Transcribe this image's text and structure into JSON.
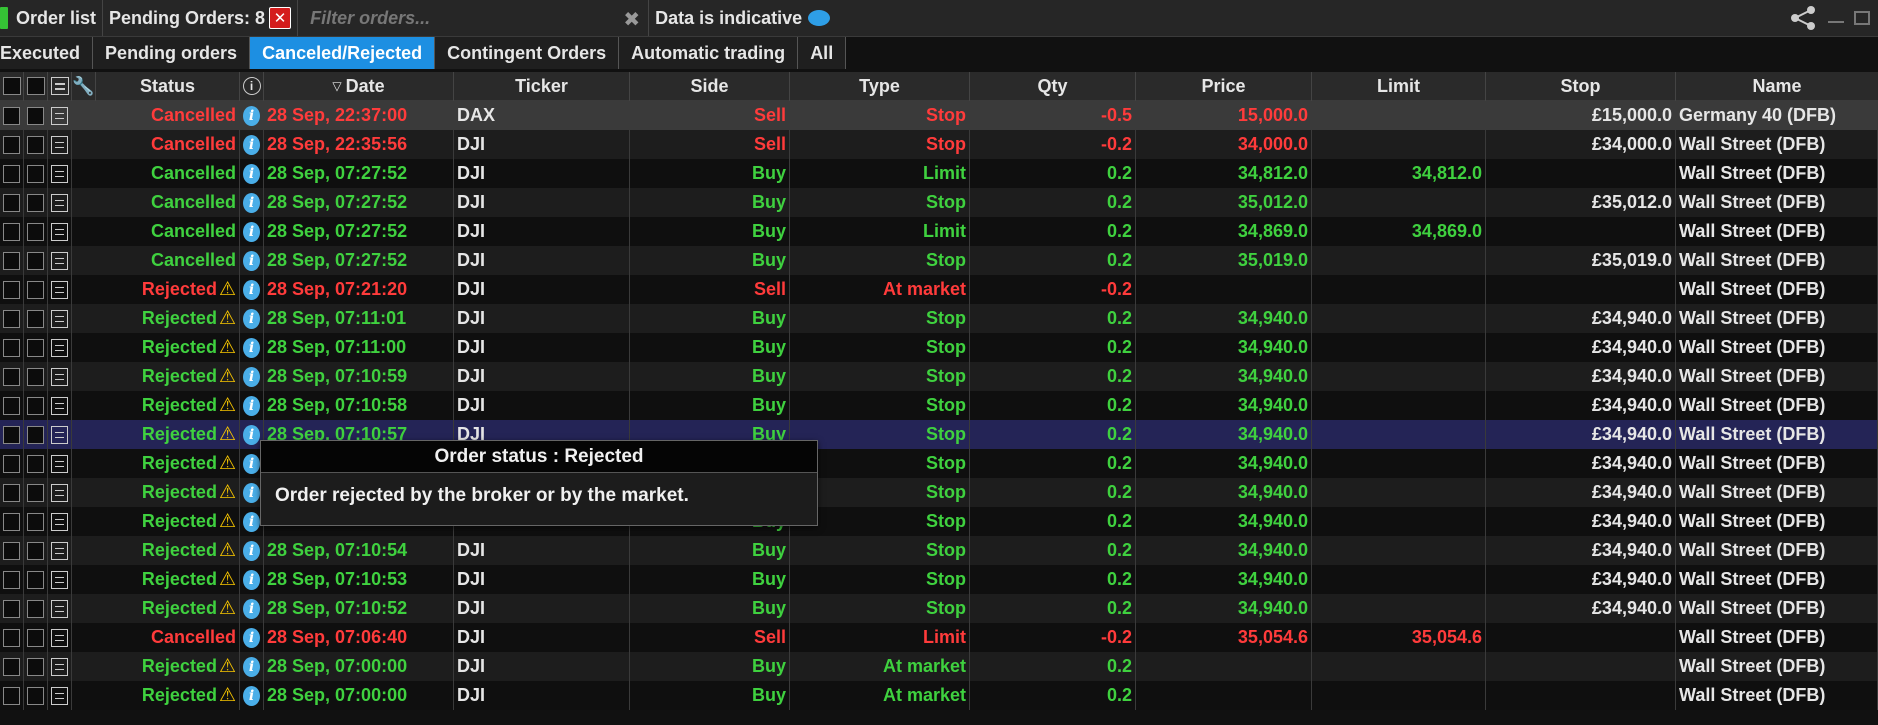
{
  "titlebar": {
    "order_list": "Order list",
    "pending_orders": "Pending Orders: 8",
    "filter_placeholder": "Filter orders...",
    "data_indicative": "Data is indicative"
  },
  "tabs": [
    {
      "label": "Executed",
      "active": false
    },
    {
      "label": "Pending orders",
      "active": false
    },
    {
      "label": "Canceled/Rejected",
      "active": true
    },
    {
      "label": "Contingent Orders",
      "active": false
    },
    {
      "label": "Automatic trading",
      "active": false
    },
    {
      "label": "All",
      "active": false
    }
  ],
  "columns": {
    "status": "Status",
    "date": "Date",
    "ticker": "Ticker",
    "side": "Side",
    "type": "Type",
    "qty": "Qty",
    "price": "Price",
    "limit": "Limit",
    "stop": "Stop",
    "name": "Name"
  },
  "colors": {
    "buy": "#3fd13f",
    "sell": "#ff3b3b",
    "active_tab": "#1d8fe2",
    "highlight_row": "#242456"
  },
  "rows": [
    {
      "status": "Cancelled",
      "warn": false,
      "date": "28 Sep, 22:37:00",
      "ticker": "DAX",
      "side": "Sell",
      "type": "Stop",
      "qty": "-0.5",
      "price": "15,000.0",
      "limit": "",
      "stop": "£15,000.0",
      "name": "Germany 40 (DFB)"
    },
    {
      "status": "Cancelled",
      "warn": false,
      "date": "28 Sep, 22:35:56",
      "ticker": "DJI",
      "side": "Sell",
      "type": "Stop",
      "qty": "-0.2",
      "price": "34,000.0",
      "limit": "",
      "stop": "£34,000.0",
      "name": "Wall Street (DFB)"
    },
    {
      "status": "Cancelled",
      "warn": false,
      "date": "28 Sep, 07:27:52",
      "ticker": "DJI",
      "side": "Buy",
      "type": "Limit",
      "qty": "0.2",
      "price": "34,812.0",
      "limit": "34,812.0",
      "stop": "",
      "name": "Wall Street (DFB)"
    },
    {
      "status": "Cancelled",
      "warn": false,
      "date": "28 Sep, 07:27:52",
      "ticker": "DJI",
      "side": "Buy",
      "type": "Stop",
      "qty": "0.2",
      "price": "35,012.0",
      "limit": "",
      "stop": "£35,012.0",
      "name": "Wall Street (DFB)"
    },
    {
      "status": "Cancelled",
      "warn": false,
      "date": "28 Sep, 07:27:52",
      "ticker": "DJI",
      "side": "Buy",
      "type": "Limit",
      "qty": "0.2",
      "price": "34,869.0",
      "limit": "34,869.0",
      "stop": "",
      "name": "Wall Street (DFB)"
    },
    {
      "status": "Cancelled",
      "warn": false,
      "date": "28 Sep, 07:27:52",
      "ticker": "DJI",
      "side": "Buy",
      "type": "Stop",
      "qty": "0.2",
      "price": "35,019.0",
      "limit": "",
      "stop": "£35,019.0",
      "name": "Wall Street (DFB)"
    },
    {
      "status": "Rejected",
      "warn": true,
      "date": "28 Sep, 07:21:20",
      "ticker": "DJI",
      "side": "Sell",
      "type": "At market",
      "qty": "-0.2",
      "price": "",
      "limit": "",
      "stop": "",
      "name": "Wall Street (DFB)"
    },
    {
      "status": "Rejected",
      "warn": true,
      "date": "28 Sep, 07:11:01",
      "ticker": "DJI",
      "side": "Buy",
      "type": "Stop",
      "qty": "0.2",
      "price": "34,940.0",
      "limit": "",
      "stop": "£34,940.0",
      "name": "Wall Street (DFB)"
    },
    {
      "status": "Rejected",
      "warn": true,
      "date": "28 Sep, 07:11:00",
      "ticker": "DJI",
      "side": "Buy",
      "type": "Stop",
      "qty": "0.2",
      "price": "34,940.0",
      "limit": "",
      "stop": "£34,940.0",
      "name": "Wall Street (DFB)"
    },
    {
      "status": "Rejected",
      "warn": true,
      "date": "28 Sep, 07:10:59",
      "ticker": "DJI",
      "side": "Buy",
      "type": "Stop",
      "qty": "0.2",
      "price": "34,940.0",
      "limit": "",
      "stop": "£34,940.0",
      "name": "Wall Street (DFB)"
    },
    {
      "status": "Rejected",
      "warn": true,
      "date": "28 Sep, 07:10:58",
      "ticker": "DJI",
      "side": "Buy",
      "type": "Stop",
      "qty": "0.2",
      "price": "34,940.0",
      "limit": "",
      "stop": "£34,940.0",
      "name": "Wall Street (DFB)"
    },
    {
      "status": "Rejected",
      "warn": true,
      "date": "28 Sep, 07:10:57",
      "ticker": "DJI",
      "side": "Buy",
      "type": "Stop",
      "qty": "0.2",
      "price": "34,940.0",
      "limit": "",
      "stop": "£34,940.0",
      "name": "Wall Street (DFB)"
    },
    {
      "status": "Rejected",
      "warn": true,
      "date": "",
      "ticker": "",
      "side": "",
      "type": "Stop",
      "qty": "0.2",
      "price": "34,940.0",
      "limit": "",
      "stop": "£34,940.0",
      "name": "Wall Street (DFB)"
    },
    {
      "status": "Rejected",
      "warn": true,
      "date": "",
      "ticker": "",
      "side": "",
      "type": "Stop",
      "qty": "0.2",
      "price": "34,940.0",
      "limit": "",
      "stop": "£34,940.0",
      "name": "Wall Street (DFB)"
    },
    {
      "status": "Rejected",
      "warn": true,
      "date": "",
      "ticker": "",
      "side": "Buy",
      "type": "Stop",
      "qty": "0.2",
      "price": "34,940.0",
      "limit": "",
      "stop": "£34,940.0",
      "name": "Wall Street (DFB)"
    },
    {
      "status": "Rejected",
      "warn": true,
      "date": "28 Sep, 07:10:54",
      "ticker": "DJI",
      "side": "Buy",
      "type": "Stop",
      "qty": "0.2",
      "price": "34,940.0",
      "limit": "",
      "stop": "£34,940.0",
      "name": "Wall Street (DFB)"
    },
    {
      "status": "Rejected",
      "warn": true,
      "date": "28 Sep, 07:10:53",
      "ticker": "DJI",
      "side": "Buy",
      "type": "Stop",
      "qty": "0.2",
      "price": "34,940.0",
      "limit": "",
      "stop": "£34,940.0",
      "name": "Wall Street (DFB)"
    },
    {
      "status": "Rejected",
      "warn": true,
      "date": "28 Sep, 07:10:52",
      "ticker": "DJI",
      "side": "Buy",
      "type": "Stop",
      "qty": "0.2",
      "price": "34,940.0",
      "limit": "",
      "stop": "£34,940.0",
      "name": "Wall Street (DFB)"
    },
    {
      "status": "Cancelled",
      "warn": false,
      "date": "28 Sep, 07:06:40",
      "ticker": "DJI",
      "side": "Sell",
      "type": "Limit",
      "qty": "-0.2",
      "price": "35,054.6",
      "limit": "35,054.6",
      "stop": "",
      "name": "Wall Street (DFB)"
    },
    {
      "status": "Rejected",
      "warn": true,
      "date": "28 Sep, 07:00:00",
      "ticker": "DJI",
      "side": "Buy",
      "type": "At market",
      "qty": "0.2",
      "price": "",
      "limit": "",
      "stop": "",
      "name": "Wall Street (DFB)"
    },
    {
      "status": "Rejected",
      "warn": true,
      "date": "28 Sep, 07:00:00",
      "ticker": "DJI",
      "side": "Buy",
      "type": "At market",
      "qty": "0.2",
      "price": "",
      "limit": "",
      "stop": "",
      "name": "Wall Street (DFB)"
    }
  ],
  "tooltip": {
    "title": "Order status : Rejected",
    "body": "Order rejected by the broker or by the market."
  }
}
